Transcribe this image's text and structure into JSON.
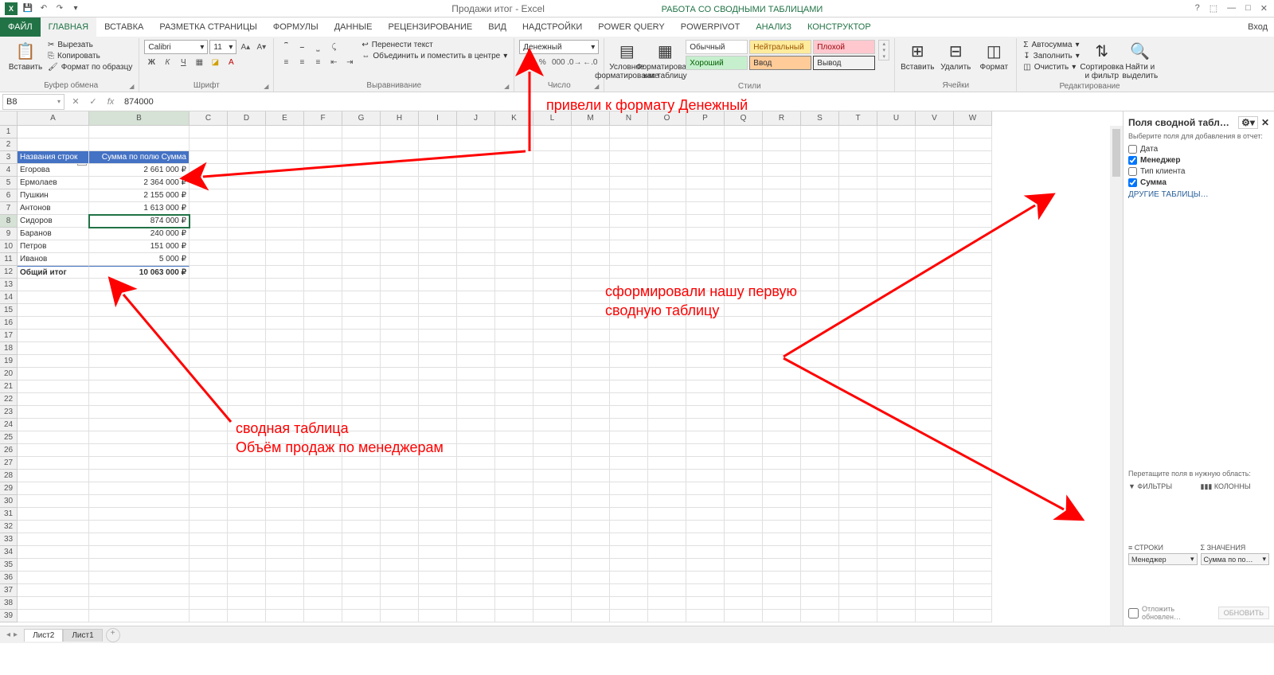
{
  "app": {
    "title": "Продажи итог - Excel",
    "context_title": "РАБОТА СО СВОДНЫМИ ТАБЛИЦАМИ",
    "sign_in": "Вход"
  },
  "tabs": {
    "file": "ФАЙЛ",
    "home": "ГЛАВНАЯ",
    "insert": "ВСТАВКА",
    "layout": "РАЗМЕТКА СТРАНИЦЫ",
    "formulas": "ФОРМУЛЫ",
    "data": "ДАННЫЕ",
    "review": "РЕЦЕНЗИРОВАНИЕ",
    "view": "ВИД",
    "addins": "НАДСТРОЙКИ",
    "powerquery": "POWER QUERY",
    "powerpivot": "POWERPIVOT",
    "analyze": "АНАЛИЗ",
    "design": "КОНСТРУКТОР"
  },
  "ribbon": {
    "clipboard": {
      "paste": "Вставить",
      "cut": "Вырезать",
      "copy": "Копировать",
      "painter": "Формат по образцу",
      "label": "Буфер обмена"
    },
    "font": {
      "name": "Calibri",
      "size": "11",
      "label": "Шрифт"
    },
    "align": {
      "wrap": "Перенести текст",
      "merge": "Объединить и поместить в центре",
      "label": "Выравнивание"
    },
    "number": {
      "format": "Денежный",
      "label": "Число"
    },
    "styles": {
      "cond": "Условное форматирование",
      "table": "Форматировать как таблицу",
      "normal": "Обычный",
      "neutral": "Нейтральный",
      "bad": "Плохой",
      "good": "Хороший",
      "input": "Ввод",
      "output": "Вывод",
      "label": "Стили"
    },
    "cells": {
      "insert": "Вставить",
      "delete": "Удалить",
      "format": "Формат",
      "label": "Ячейки"
    },
    "editing": {
      "autosum": "Автосумма",
      "fill": "Заполнить",
      "clear": "Очистить",
      "sort": "Сортировка и фильтр",
      "find": "Найти и выделить",
      "label": "Редактирование"
    }
  },
  "formula_bar": {
    "cell_ref": "B8",
    "value": "874000"
  },
  "columns": [
    "A",
    "B",
    "C",
    "D",
    "E",
    "F",
    "G",
    "H",
    "I",
    "J",
    "K",
    "L",
    "M",
    "N",
    "O",
    "P",
    "Q",
    "R",
    "S",
    "T",
    "U",
    "V",
    "W"
  ],
  "col_widths": {
    "A": 90,
    "B": 126,
    "default": 48
  },
  "pivot": {
    "header_row": "Названия строк",
    "header_val": "Сумма по полю Сумма",
    "rows": [
      {
        "name": "Егорова",
        "val": "2 661 000 ₽"
      },
      {
        "name": "Ермолаев",
        "val": "2 364 000 ₽"
      },
      {
        "name": "Пушкин",
        "val": "2 155 000 ₽"
      },
      {
        "name": "Антонов",
        "val": "1 613 000 ₽"
      },
      {
        "name": "Сидоров",
        "val": "874 000 ₽"
      },
      {
        "name": "Баранов",
        "val": "240 000 ₽"
      },
      {
        "name": "Петров",
        "val": "151 000 ₽"
      },
      {
        "name": "Иванов",
        "val": "5 000 ₽"
      }
    ],
    "total_label": "Общий итог",
    "total_val": "10 063 000 ₽"
  },
  "field_pane": {
    "title": "Поля сводной табл…",
    "subtitle": "Выберите поля для добавления в отчет:",
    "fields": [
      {
        "name": "Дата",
        "checked": false
      },
      {
        "name": "Менеджер",
        "checked": true
      },
      {
        "name": "Тип клиента",
        "checked": false
      },
      {
        "name": "Сумма",
        "checked": true
      }
    ],
    "other_tables": "ДРУГИЕ ТАБЛИЦЫ…",
    "drag_label": "Перетащите поля в нужную область:",
    "filters": "ФИЛЬТРЫ",
    "columns": "КОЛОННЫ",
    "rows": "СТРОКИ",
    "values": "ЗНАЧЕНИЯ",
    "row_pill": "Менеджер",
    "val_pill": "Сумма по по…",
    "defer": "Отложить обновлен…",
    "update": "ОБНОВИТЬ"
  },
  "sheets": {
    "active": "Лист2",
    "other": "Лист1"
  },
  "annotations": {
    "a1": "привели к формату Денежный",
    "a2_l1": "сформировали нашу первую",
    "a2_l2": "сводную таблицу",
    "a3_l1": "сводная таблица",
    "a3_l2": "Объём продаж по менеджерам"
  }
}
